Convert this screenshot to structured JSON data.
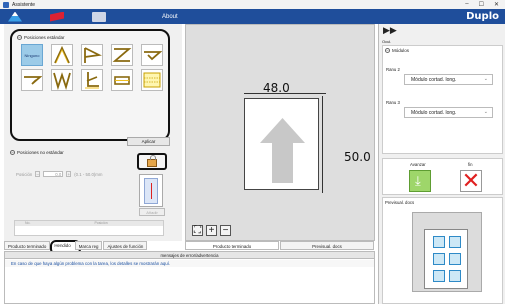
{
  "window": {
    "title": "Assistente",
    "controls": [
      "–",
      "☐",
      "✕"
    ]
  },
  "menubar": {
    "about_label": "About",
    "brand": "Duplo"
  },
  "standard_positions": {
    "header": "Posiciones estándar",
    "none_label": "Ninguno",
    "apply_label": "Aplicar"
  },
  "nonstandard_positions": {
    "header": "Posiciones no estándar",
    "position_label": "Posición",
    "minus": "–",
    "value": "0.0",
    "plus": "+",
    "range": "(0.1 - 50.0)mm",
    "add_label": "Añadir",
    "table_headers": [
      "No.",
      "Posición"
    ]
  },
  "left_tabs": [
    "Producto terminado",
    "Hendido",
    "Marca reg",
    "Ajustes de función"
  ],
  "preview": {
    "width_value": "48.0",
    "height_value": "50.0",
    "tools": [
      "⛶",
      "+",
      "−"
    ]
  },
  "center_tabs": [
    "Producto terminado",
    "Previsual. docs"
  ],
  "right": {
    "hide_label": "Ocul.",
    "modules_header": "Módulos",
    "slot2_label": "Ranu 2",
    "slot2_value": "Módulo cortad. long.",
    "slot3_label": "Ranu 3",
    "slot3_value": "Módulo cortad. long.",
    "advance_label": "Avanzar",
    "end_label": "fin",
    "doc_preview_label": "Previsual. docs"
  },
  "messages": {
    "header": "mensajes de error/advertencia",
    "line": "En caso de que haya algún problema con la tarea, los detalles se mostrarán aquí."
  }
}
